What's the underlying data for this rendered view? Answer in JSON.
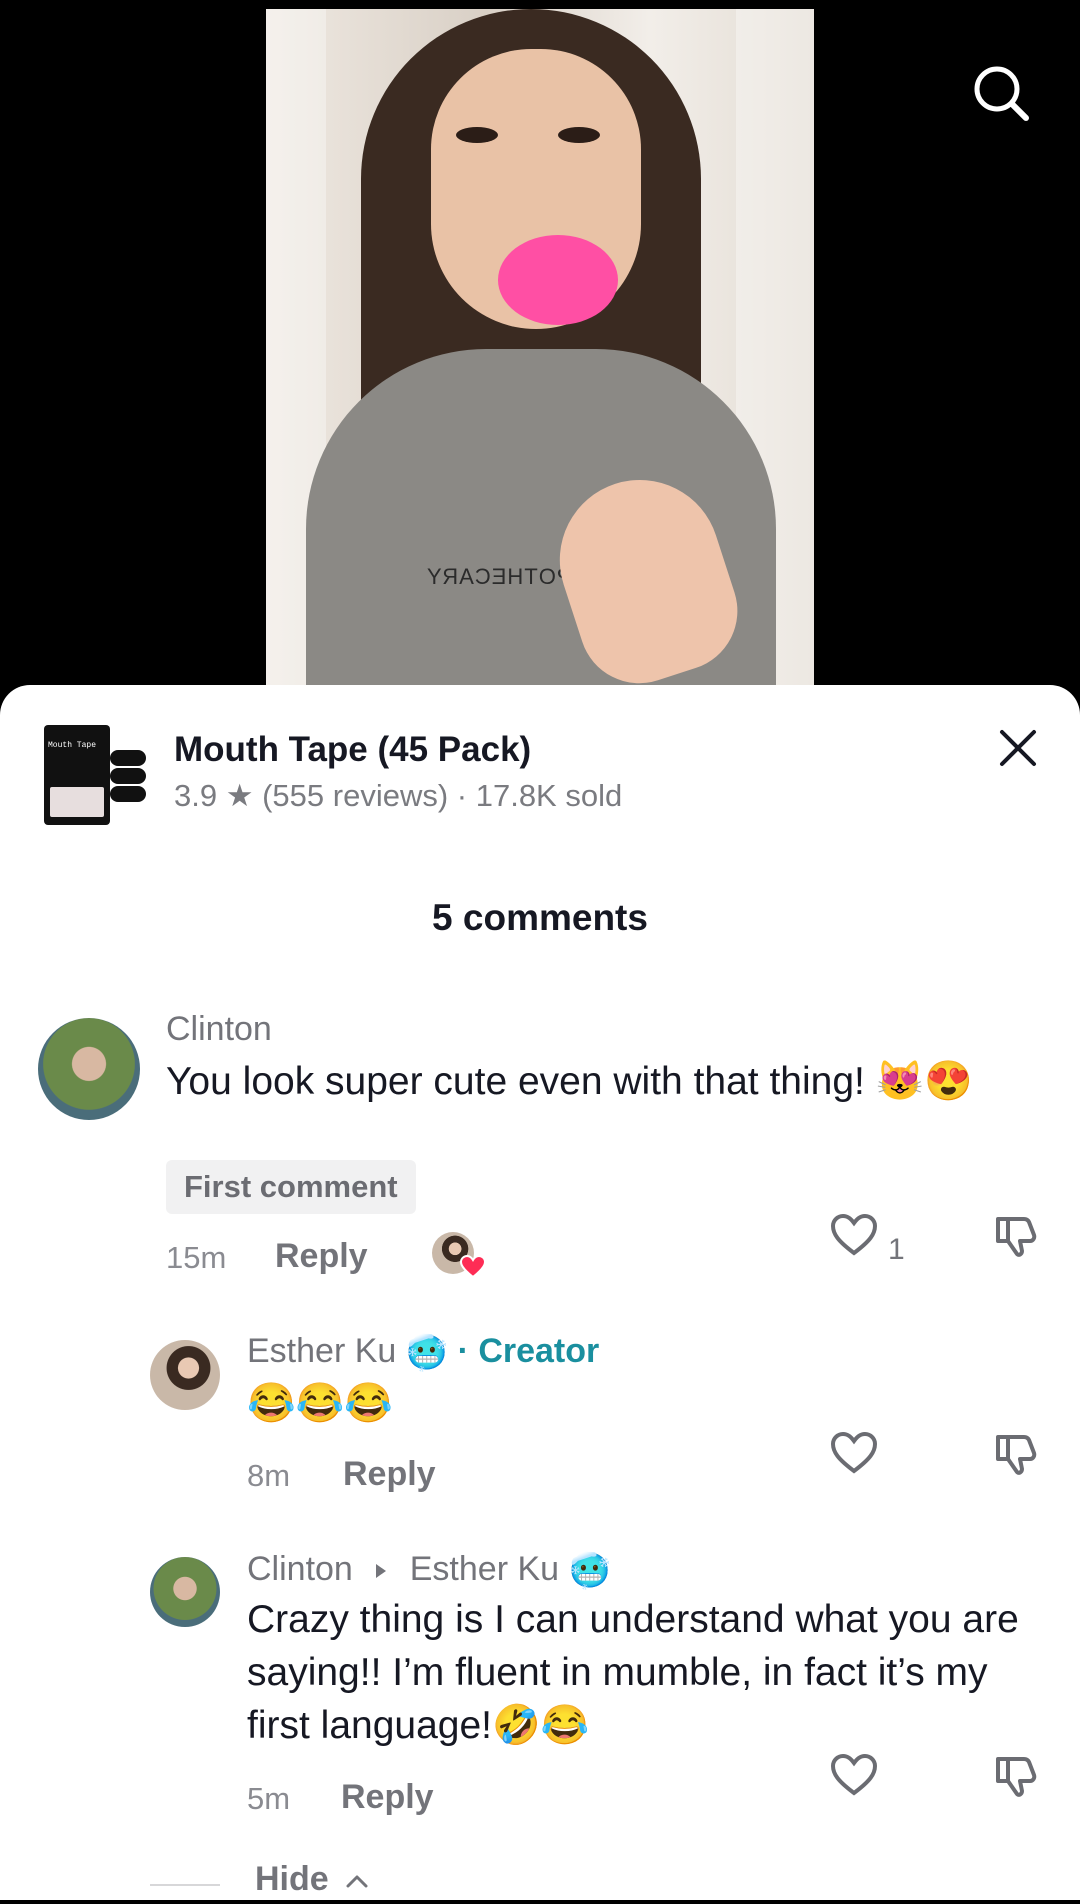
{
  "product": {
    "title": "Mouth Tape (45 Pack)",
    "meta": "3.9 ★ (555 reviews) · 17.8K sold",
    "thumb_label": "Mouth Tape"
  },
  "video": {
    "shirt_text": "APOTHECARY"
  },
  "comments_count": "5 comments",
  "comments": [
    {
      "username": "Clinton",
      "text": "You look super cute even with that thing! 😻😍",
      "badge": "First comment",
      "time": "15m",
      "reply_label": "Reply",
      "like_count": "1"
    }
  ],
  "replies": [
    {
      "username": "Esther Ku",
      "username_emoji": "🥶",
      "creator_label": "· Creator",
      "text": "😂😂😂",
      "time": "8m",
      "reply_label": "Reply"
    },
    {
      "username": "Clinton",
      "reply_to": "Esther Ku",
      "reply_to_emoji": "🥶",
      "text": "Crazy thing is I can understand what you are saying!! I’m fluent in mumble, in fact it’s my first language!🤣😂",
      "time": "5m",
      "reply_label": "Reply"
    }
  ],
  "hide_label": "Hide",
  "colors": {
    "accent_creator": "#1a8f9f",
    "tape_pink": "#ff4fa4",
    "liked_heart": "#fe2c55"
  },
  "icons": [
    "search-icon",
    "close-icon",
    "heart-outline-icon",
    "dislike-icon",
    "chevron-up-icon",
    "reply-arrow-icon"
  ]
}
